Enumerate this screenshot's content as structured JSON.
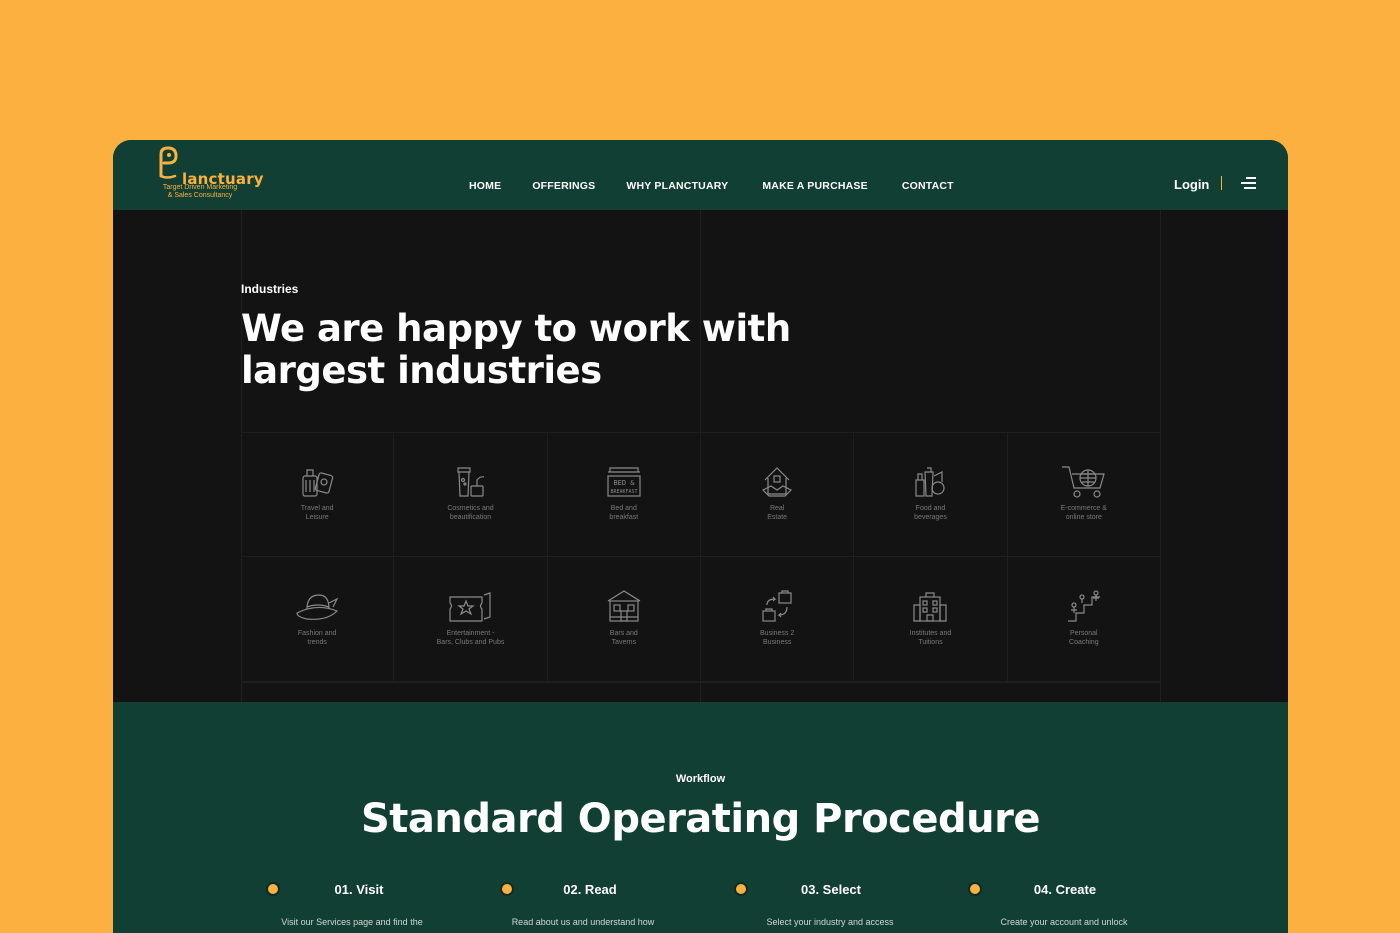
{
  "brand": {
    "name": "lanctuary",
    "tagline_line1": "Target Driven Marketing",
    "tagline_line2": "& Sales Consultancy",
    "accent": "#FBB040",
    "primary": "#123F33",
    "dark": "#131313"
  },
  "nav": {
    "items": [
      "HOME",
      "OFFERINGS",
      "WHY PLANCTUARY",
      "MAKE A PURCHASE",
      "CONTACT"
    ],
    "login": "Login",
    "menu_icon": "hamburger-icon"
  },
  "industries": {
    "kicker": "Industries",
    "title_line1": "We are happy to work with",
    "title_line2": "largest industries",
    "items": [
      {
        "label": "Travel and\nLeisure",
        "icon": "luggage-icon"
      },
      {
        "label": "Cosmetics and\nbeautification",
        "icon": "cosmetics-icon"
      },
      {
        "label": "Bed and\nbreakfast",
        "icon": "bed-breakfast-icon"
      },
      {
        "label": "Real\nEstate",
        "icon": "real-estate-icon"
      },
      {
        "label": "Food and\nbeverages",
        "icon": "food-beverages-icon"
      },
      {
        "label": "E-commerce &\nonline store",
        "icon": "cart-globe-icon"
      },
      {
        "label": "Fashion and\ntrends",
        "icon": "hat-icon"
      },
      {
        "label": "Entertainment -\nBars, Clubs and Pubs",
        "icon": "tickets-icon"
      },
      {
        "label": "Bars and\nTaverns",
        "icon": "tavern-icon"
      },
      {
        "label": "Business 2\nBusiness",
        "icon": "b2b-icon"
      },
      {
        "label": "Institutes and\nTuitions",
        "icon": "institute-icon"
      },
      {
        "label": "Personal\nCoaching",
        "icon": "coaching-icon"
      }
    ]
  },
  "workflow": {
    "kicker": "Workflow",
    "title": "Standard Operating Procedure",
    "steps": [
      {
        "title": "01. Visit",
        "text": "Visit our Services page and find the"
      },
      {
        "title": "02. Read",
        "text": "Read about us and understand how"
      },
      {
        "title": "03. Select",
        "text": "Select your industry and access"
      },
      {
        "title": "04. Create",
        "text": "Create your account and unlock"
      }
    ]
  }
}
